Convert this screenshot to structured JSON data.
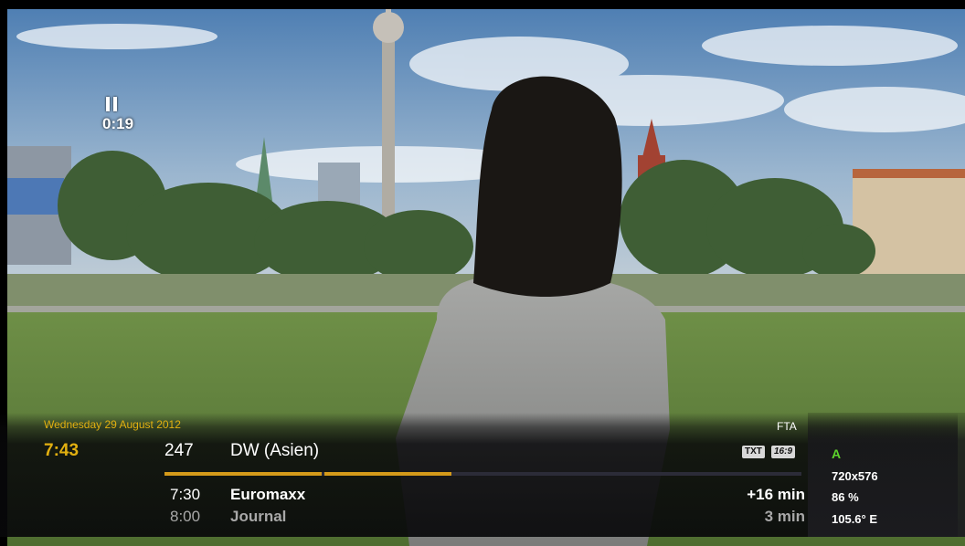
{
  "playback": {
    "state_icon": "pause-icon",
    "elapsed": "0:19"
  },
  "infobar": {
    "date": "Wednesday 29 August 2012",
    "clock": "7:43",
    "channel_number": "247",
    "channel_name": "DW (Asien)",
    "encryption": "FTA",
    "badges": {
      "teletext": "TXT",
      "aspect": "16:9"
    },
    "progress": {
      "segments": [
        0.25,
        0.2
      ]
    },
    "now": {
      "start": "7:30",
      "title": "Euromaxx",
      "remaining": "+16 min"
    },
    "next": {
      "start": "8:00",
      "title": "Journal",
      "duration": "3 min"
    },
    "tech": {
      "audio": "A",
      "resolution": "720x576",
      "signal": "86 %",
      "satellite": "105.6° E"
    },
    "colors": {
      "accent": "#e2b010",
      "audio": "#5dd42c",
      "text": "#ffffff",
      "dim": "#a8a8a8"
    }
  }
}
